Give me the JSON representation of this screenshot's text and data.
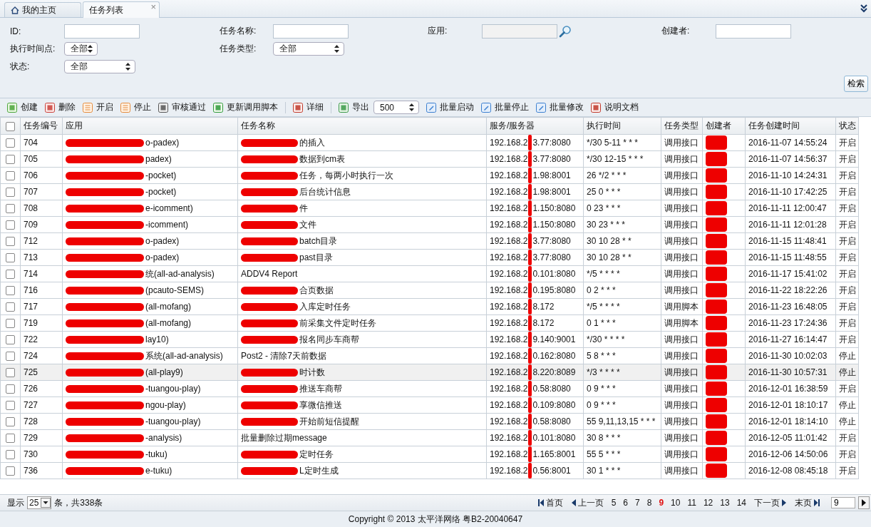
{
  "tabs": [
    {
      "label": "我的主页",
      "selected": false
    },
    {
      "label": "任务列表",
      "selected": true,
      "close": "×"
    }
  ],
  "filters": [
    {
      "label": "ID:",
      "kind": "input"
    },
    {
      "label": "任务名称:",
      "kind": "input"
    },
    {
      "label": "应用:",
      "kind": "lookup",
      "disabled": true
    },
    {
      "label": "创建者:",
      "kind": "input"
    },
    {
      "label": "执行时间点:",
      "kind": "select",
      "value": "全部"
    },
    {
      "label": "任务类型:",
      "kind": "select",
      "value": "全部"
    },
    {
      "kind": "empty"
    },
    {
      "kind": "empty"
    },
    {
      "label": "状态:",
      "kind": "select",
      "value": "全部"
    }
  ],
  "search_button": "检索",
  "toolbar": [
    {
      "kind": "button",
      "label": "创建"
    },
    {
      "kind": "button",
      "label": "删除"
    },
    {
      "kind": "button",
      "label": "开启"
    },
    {
      "kind": "button",
      "label": "停止"
    },
    {
      "kind": "button",
      "label": "审核通过"
    },
    {
      "kind": "button",
      "label": "更新调用脚本"
    },
    {
      "kind": "separator"
    },
    {
      "kind": "button",
      "label": "详细"
    },
    {
      "kind": "separator"
    },
    {
      "kind": "button",
      "label": "导出"
    },
    {
      "kind": "select",
      "value": "500"
    },
    {
      "kind": "button",
      "label": "批量启动"
    },
    {
      "kind": "button",
      "label": "批量停止"
    },
    {
      "kind": "button",
      "label": "批量修改"
    },
    {
      "kind": "button",
      "label": "说明文档"
    }
  ],
  "table": {
    "header_checked": false,
    "columns": [
      "任务编号",
      "应用",
      "任务名称",
      "服务/服务器",
      "执行时间",
      "任务类型",
      "创建者",
      "任务创建时间",
      "状态"
    ],
    "rows": [
      {
        "checked": false,
        "highlighted": false,
        "id": "704",
        "app": "o-padex)",
        "name": "的插入",
        "name_redacted": true,
        "server_prefix": "192.168.2",
        "server_suffix": "3.77:8080",
        "cron": "*/30 5-11 * * *",
        "type": "调用接口",
        "created": "2016-11-07 14:55:24",
        "status": "开启"
      },
      {
        "checked": false,
        "highlighted": false,
        "id": "705",
        "app": "padex)",
        "name": "数据到cm表",
        "name_redacted": true,
        "server_prefix": "192.168.2",
        "server_suffix": "3.77:8080",
        "cron": "*/30 12-15 * * *",
        "type": "调用接口",
        "created": "2016-11-07 14:56:37",
        "status": "开启"
      },
      {
        "checked": false,
        "highlighted": false,
        "id": "706",
        "app": "-pocket)",
        "name": "任务，每两小时执行一次",
        "name_redacted": true,
        "server_prefix": "192.168.2",
        "server_suffix": "1.98:8001",
        "cron": "26 */2 * * *",
        "type": "调用接口",
        "created": "2016-11-10 14:24:31",
        "status": "开启"
      },
      {
        "checked": false,
        "highlighted": false,
        "id": "707",
        "app": "-pocket)",
        "name": "后台统计信息",
        "name_redacted": true,
        "server_prefix": "192.168.2",
        "server_suffix": "1.98:8001",
        "cron": "25 0 * * *",
        "type": "调用接口",
        "created": "2016-11-10 17:42:25",
        "status": "开启"
      },
      {
        "checked": false,
        "highlighted": false,
        "id": "708",
        "app": "e-icomment)",
        "name": "件",
        "name_redacted": true,
        "server_prefix": "192.168.2",
        "server_suffix": "1.150:8080",
        "cron": "0 23 * * *",
        "type": "调用接口",
        "created": "2016-11-11 12:00:47",
        "status": "开启"
      },
      {
        "checked": false,
        "highlighted": false,
        "id": "709",
        "app": "-icomment)",
        "name": "文件",
        "name_redacted": true,
        "server_prefix": "192.168.2",
        "server_suffix": "1.150:8080",
        "cron": "30 23 * * *",
        "type": "调用接口",
        "created": "2016-11-11 12:01:28",
        "status": "开启"
      },
      {
        "checked": false,
        "highlighted": false,
        "id": "712",
        "app": "o-padex)",
        "name": "batch目录",
        "name_redacted": true,
        "server_prefix": "192.168.2",
        "server_suffix": "3.77:8080",
        "cron": "30 10 28 * *",
        "type": "调用接口",
        "created": "2016-11-15 11:48:41",
        "status": "开启"
      },
      {
        "checked": false,
        "highlighted": false,
        "id": "713",
        "app": "o-padex)",
        "name": "past目录",
        "name_redacted": true,
        "server_prefix": "192.168.2",
        "server_suffix": "3.77:8080",
        "cron": "30 10 28 * *",
        "type": "调用接口",
        "created": "2016-11-15 11:48:55",
        "status": "开启"
      },
      {
        "checked": false,
        "highlighted": false,
        "id": "714",
        "app": "统(all-ad-analysis)",
        "name": "ADDV4 Report",
        "name_redacted": false,
        "server_prefix": "192.168.2",
        "server_suffix": "0.101:8080",
        "cron": "*/5 * * * *",
        "type": "调用接口",
        "created": "2016-11-17 15:41:02",
        "status": "开启"
      },
      {
        "checked": false,
        "highlighted": false,
        "id": "716",
        "app": "(pcauto-SEMS)",
        "name": "合页数据",
        "name_redacted": true,
        "server_prefix": "192.168.2",
        "server_suffix": "0.195:8080",
        "cron": "0 2 * * *",
        "type": "调用接口",
        "created": "2016-11-22 18:22:26",
        "status": "开启"
      },
      {
        "checked": false,
        "highlighted": false,
        "id": "717",
        "app": "(all-mofang)",
        "name": "入库定时任务",
        "name_redacted": true,
        "server_prefix": "192.168.2",
        "server_suffix": "8.172",
        "cron": "*/5 * * * *",
        "type": "调用脚本",
        "created": "2016-11-23 16:48:05",
        "status": "开启"
      },
      {
        "checked": false,
        "highlighted": false,
        "id": "719",
        "app": "(all-mofang)",
        "name": "前采集文件定时任务",
        "name_redacted": true,
        "server_prefix": "192.168.2",
        "server_suffix": "8.172",
        "cron": "0 1 * * *",
        "type": "调用脚本",
        "created": "2016-11-23 17:24:36",
        "status": "开启"
      },
      {
        "checked": false,
        "highlighted": false,
        "id": "722",
        "app": "lay10)",
        "name": "报名同步车商帮",
        "name_redacted": true,
        "server_prefix": "192.168.2",
        "server_suffix": "9.140:9001",
        "cron": "*/30 * * * *",
        "type": "调用接口",
        "created": "2016-11-27 16:14:47",
        "status": "开启"
      },
      {
        "checked": false,
        "highlighted": false,
        "id": "724",
        "app": "系统(all-ad-analysis)",
        "name": "Post2 - 清除7天前数据",
        "name_redacted": false,
        "server_prefix": "192.168.2",
        "server_suffix": "0.162:8080",
        "cron": "5 8 * * *",
        "type": "调用接口",
        "created": "2016-11-30 10:02:03",
        "status": "停止"
      },
      {
        "checked": false,
        "highlighted": true,
        "id": "725",
        "app": "(all-play9)",
        "name": "时计数",
        "name_redacted": true,
        "server_prefix": "192.168.2",
        "server_suffix": "8.220:8089",
        "cron": "*/3 * * * *",
        "type": "调用接口",
        "created": "2016-11-30 10:57:31",
        "status": "停止"
      },
      {
        "checked": false,
        "highlighted": false,
        "id": "726",
        "app": "-tuangou-play)",
        "name": "推送车商帮",
        "name_redacted": true,
        "server_prefix": "192.168.2",
        "server_suffix": "0.58:8080",
        "cron": "0 9 * * *",
        "type": "调用接口",
        "created": "2016-12-01 16:38:59",
        "status": "开启"
      },
      {
        "checked": false,
        "highlighted": false,
        "id": "727",
        "app": "ngou-play)",
        "name": "享微信推送",
        "name_redacted": true,
        "server_prefix": "192.168.2",
        "server_suffix": "0.109:8080",
        "cron": "0 9 * * *",
        "type": "调用接口",
        "created": "2016-12-01 18:10:17",
        "status": "停止"
      },
      {
        "checked": false,
        "highlighted": false,
        "id": "728",
        "app": "-tuangou-play)",
        "name": "开始前短信提醒",
        "name_redacted": true,
        "server_prefix": "192.168.2",
        "server_suffix": "0.58:8080",
        "cron": "55 9,11,13,15 * * *",
        "type": "调用接口",
        "created": "2016-12-01 18:14:10",
        "status": "停止"
      },
      {
        "checked": false,
        "highlighted": false,
        "id": "729",
        "app": "-analysis)",
        "name": "批量删除过期message",
        "name_redacted": false,
        "server_prefix": "192.168.2",
        "server_suffix": "0.101:8080",
        "cron": "30 8 * * *",
        "type": "调用接口",
        "created": "2016-12-05 11:01:42",
        "status": "开启"
      },
      {
        "checked": false,
        "highlighted": false,
        "id": "730",
        "app": "-tuku)",
        "name": "定时任务",
        "name_redacted": true,
        "server_prefix": "192.168.2",
        "server_suffix": "1.165:8001",
        "cron": "55 5 * * *",
        "type": "调用接口",
        "created": "2016-12-06 14:50:06",
        "status": "开启"
      },
      {
        "checked": false,
        "highlighted": false,
        "id": "736",
        "app": "e-tuku)",
        "name": "L定时生成",
        "name_redacted": true,
        "server_prefix": "192.168.2",
        "server_suffix": "0.56:8001",
        "cron": "30 1 * * *",
        "type": "调用接口",
        "created": "2016-12-08 08:45:18",
        "status": "开启"
      }
    ]
  },
  "footer": {
    "show_label": "显示",
    "page_size": "25",
    "total": "条，共338条",
    "first": "首页",
    "prev": "上一页",
    "pages": [
      {
        "label": "5",
        "selected": false
      },
      {
        "label": "6",
        "selected": false
      },
      {
        "label": "7",
        "selected": false
      },
      {
        "label": "8",
        "selected": false
      },
      {
        "label": "9",
        "selected": true
      },
      {
        "label": "10",
        "selected": false
      },
      {
        "label": "11",
        "selected": false
      },
      {
        "label": "12",
        "selected": false
      },
      {
        "label": "13",
        "selected": false
      },
      {
        "label": "14",
        "selected": false
      }
    ],
    "next": "下一页",
    "last": "末页",
    "page_input": "9"
  },
  "copyright": "Copyright © 2013 太平洋网络 粤B2-20040647"
}
